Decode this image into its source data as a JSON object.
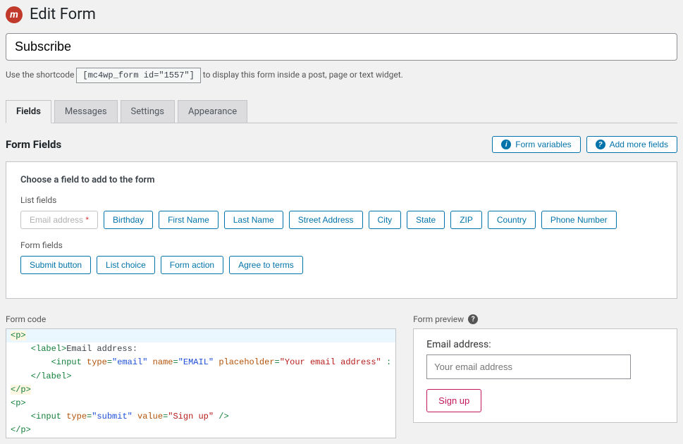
{
  "page": {
    "title": "Edit Form"
  },
  "form_title": "Subscribe",
  "shortcode": {
    "prefix": "Use the shortcode",
    "code": "[mc4wp_form id=\"1557\"]",
    "suffix": "to display this form inside a post, page or text widget."
  },
  "tabs": [
    "Fields",
    "Messages",
    "Settings",
    "Appearance"
  ],
  "section": {
    "title": "Form Fields"
  },
  "top_buttons": {
    "variables": "Form variables",
    "add_more": "Add more fields"
  },
  "panel": {
    "choose_label": "Choose a field to add to the form",
    "list_label": "List fields",
    "form_label": "Form fields"
  },
  "list_fields": [
    {
      "label": "Email address",
      "required": true,
      "faded": true
    },
    {
      "label": "Birthday"
    },
    {
      "label": "First Name"
    },
    {
      "label": "Last Name"
    },
    {
      "label": "Street Address"
    },
    {
      "label": "City"
    },
    {
      "label": "State"
    },
    {
      "label": "ZIP"
    },
    {
      "label": "Country"
    },
    {
      "label": "Phone Number"
    }
  ],
  "form_fields": [
    "Submit button",
    "List choice",
    "Form action",
    "Agree to terms"
  ],
  "code_sec": {
    "title": "Form code"
  },
  "preview_sec": {
    "title": "Form preview"
  },
  "preview": {
    "label": "Email address:",
    "placeholder": "Your email address",
    "button": "Sign up"
  },
  "code_lines": {
    "l1": "<p>",
    "l2_pre": "    <label>",
    "l2_txt": "Email address:",
    "l3_pre": "        <input ",
    "l3_a1": "type",
    "l3_v1": "\"email\"",
    "l3_a2": "name",
    "l3_v2": "\"EMAIL\"",
    "l3_a3": "placeholder",
    "l3_v3": "\"Your email address\"",
    "l4": "    </label>",
    "l5": "</p>",
    "l6": "<p>",
    "l7_pre": "    <input ",
    "l7_a1": "type",
    "l7_v1": "\"submit\"",
    "l7_a2": "value",
    "l7_v2": "\"Sign up\"",
    "l7_end": " />",
    "l8": "</p>"
  }
}
